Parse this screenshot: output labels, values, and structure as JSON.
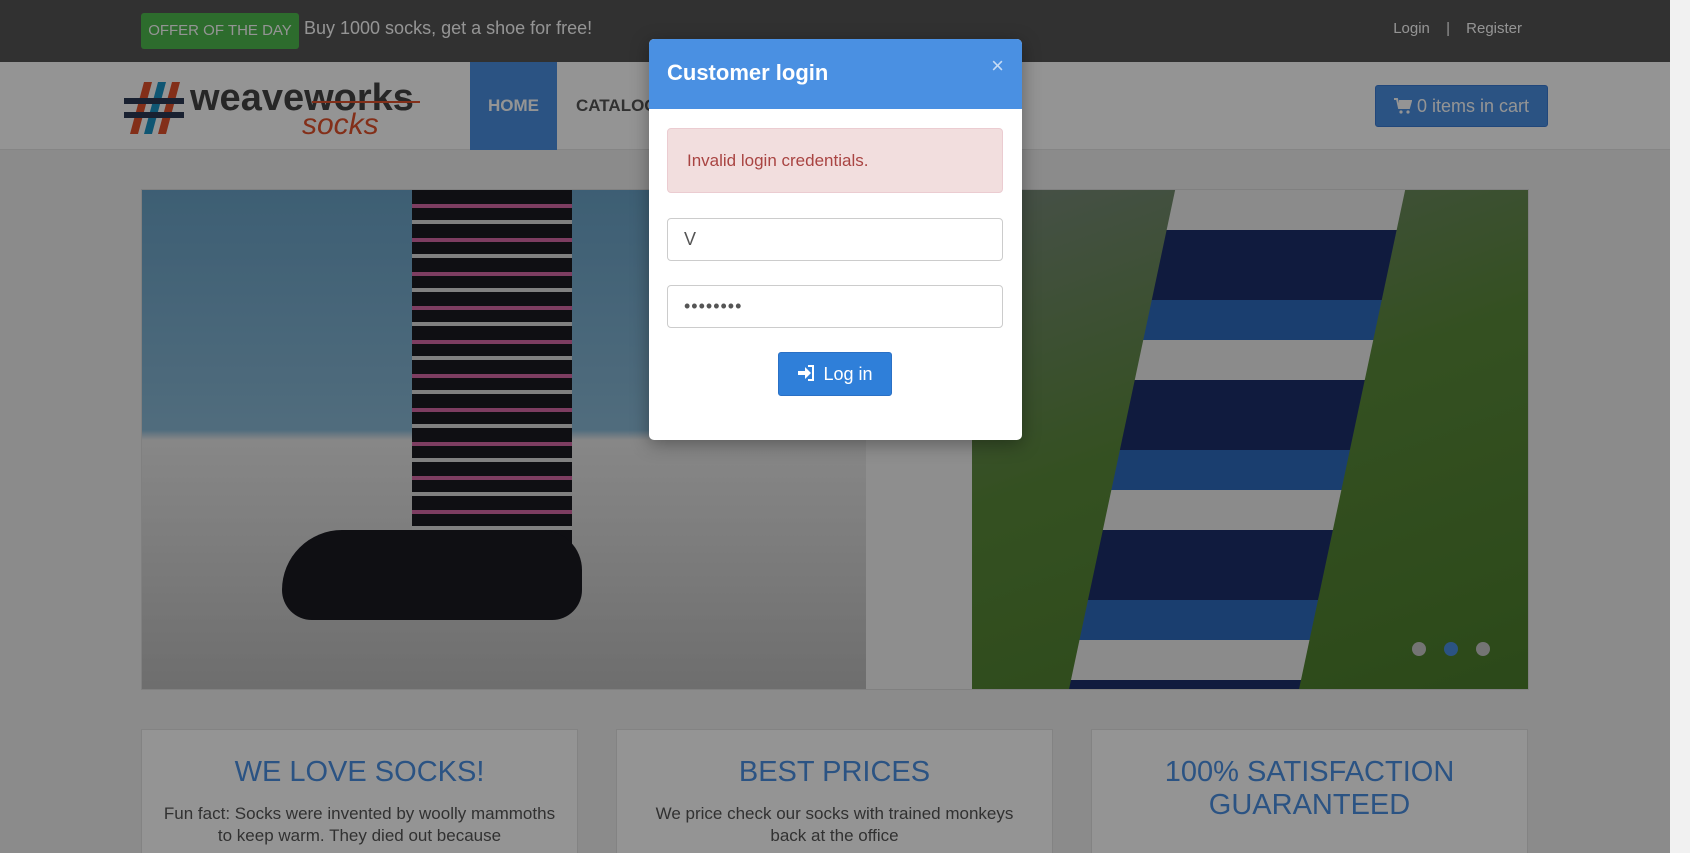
{
  "topbar": {
    "offer_badge": "OFFER OF THE DAY",
    "offer_text": "Buy 1000 socks, get a shoe for free!",
    "login_link": "Login",
    "separator": "|",
    "register_link": "Register"
  },
  "navbar": {
    "logo_text_main": "weaveworks",
    "logo_text_sub": "socks",
    "items": [
      {
        "label": "HOME",
        "active": true
      },
      {
        "label": "CATALOG",
        "active": false
      }
    ],
    "cart_label": "0 items in cart"
  },
  "hero": {
    "slide_count": 3,
    "active_slide": 2
  },
  "cards": [
    {
      "title": "WE LOVE SOCKS!",
      "text": "Fun fact: Socks were invented by woolly mammoths to keep warm. They died out because"
    },
    {
      "title": "BEST PRICES",
      "text": "We price check our socks with trained monkeys back at the office"
    },
    {
      "title": "100% SATISFACTION GUARANTEED",
      "text": ""
    }
  ],
  "modal": {
    "title": "Customer login",
    "close": "×",
    "alert": "Invalid login credentials.",
    "username_value": "V",
    "password_value": "••••••••",
    "login_button": "Log in"
  },
  "colors": {
    "accent": "#4a90e2",
    "offer_green": "#4fbb4f",
    "alert_bg": "#f2dede",
    "alert_text": "#a94442",
    "topbar": "#555555"
  }
}
